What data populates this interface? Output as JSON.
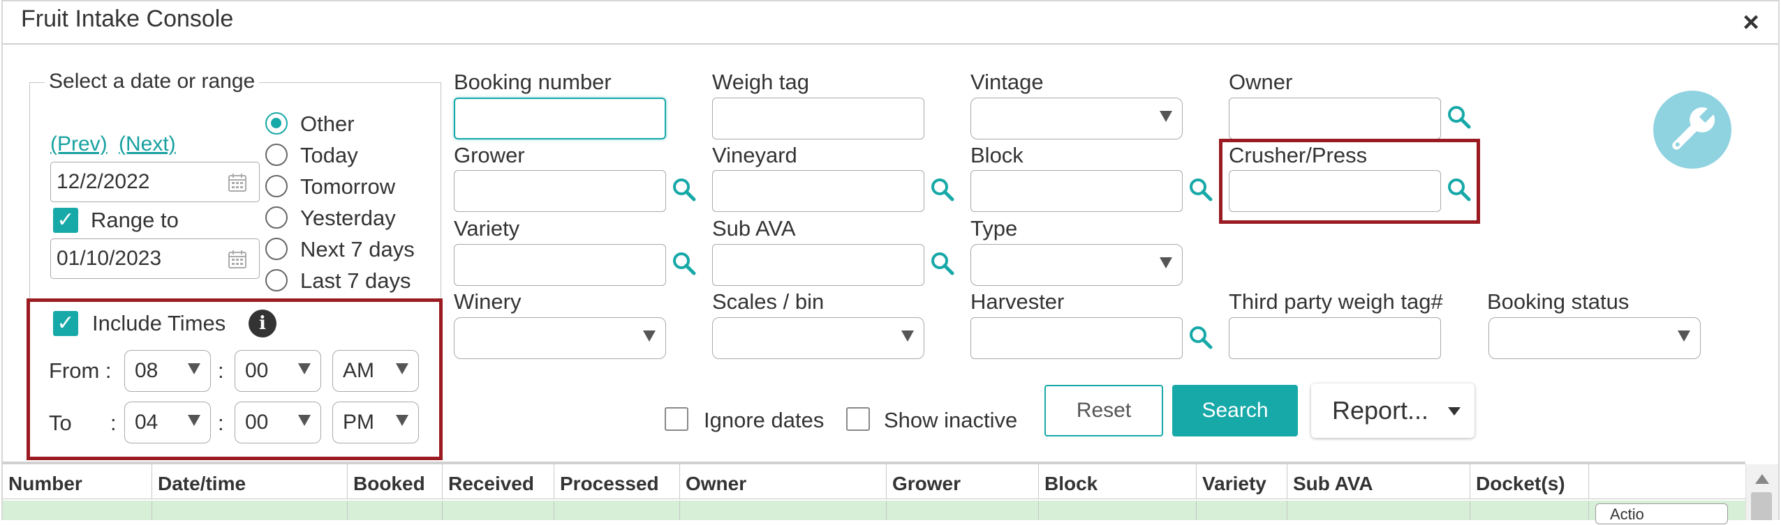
{
  "window": {
    "title": "Fruit Intake Console",
    "close_glyph": "×"
  },
  "date_panel": {
    "legend": "Select a date or range",
    "prev_link": "(Prev)",
    "next_link": "(Next)",
    "date_from": "12/2/2022",
    "range_to_label": "Range to",
    "range_to_checked": true,
    "date_to": "01/10/2023",
    "radios": [
      {
        "label": "Other",
        "selected": true
      },
      {
        "label": "Today",
        "selected": false
      },
      {
        "label": "Tomorrow",
        "selected": false
      },
      {
        "label": "Yesterday",
        "selected": false
      },
      {
        "label": "Next 7 days",
        "selected": false
      },
      {
        "label": "Last 7 days",
        "selected": false
      }
    ]
  },
  "times": {
    "include_label": "Include Times",
    "include_checked": true,
    "from_label": "From :",
    "to_label": "To",
    "to_colon": ":",
    "sep": ":",
    "from_hour": "08",
    "from_min": "00",
    "from_ampm": "AM",
    "to_hour": "04",
    "to_min": "00",
    "to_ampm": "PM"
  },
  "filters": {
    "booking_number": "Booking number",
    "weigh_tag": "Weigh tag",
    "vintage": "Vintage",
    "owner": "Owner",
    "grower": "Grower",
    "vineyard": "Vineyard",
    "block": "Block",
    "crusher_press": "Crusher/Press",
    "variety": "Variety",
    "sub_ava": "Sub AVA",
    "type": "Type",
    "winery": "Winery",
    "scales_bin": "Scales / bin",
    "harvester": "Harvester",
    "third_party": "Third party weigh tag#",
    "booking_status": "Booking status"
  },
  "options": {
    "ignore_dates": "Ignore dates",
    "show_inactive": "Show inactive"
  },
  "buttons": {
    "reset": "Reset",
    "search": "Search",
    "report": "Report..."
  },
  "grid": {
    "columns": [
      "Number",
      "Date/time",
      "Booked",
      "Received",
      "Processed",
      "Owner",
      "Grower",
      "Block",
      "Variety",
      "Sub AVA",
      "Docket(s)"
    ],
    "row_button_partial": "Actio"
  },
  "colors": {
    "accent": "#17a8a8",
    "highlight_border": "#9b1b22",
    "row_bg": "#d6efd6",
    "wrench_bg": "#8fd2e0"
  },
  "icons": [
    "close-icon",
    "calendar-icon",
    "search-icon",
    "info-icon",
    "wrench-icon",
    "chevron-down-icon"
  ]
}
